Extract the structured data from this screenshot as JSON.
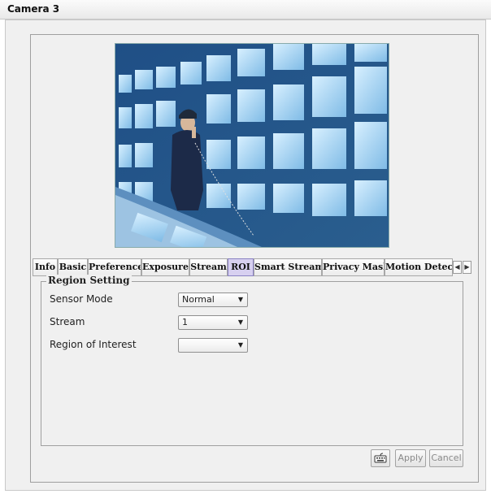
{
  "window": {
    "title": "Camera 3"
  },
  "tabs": [
    {
      "label": "Info"
    },
    {
      "label": "Basic"
    },
    {
      "label": "Preference"
    },
    {
      "label": "Exposure"
    },
    {
      "label": "Stream"
    },
    {
      "label": "ROI",
      "active": true
    },
    {
      "label": "Smart Stream"
    },
    {
      "label": "Privacy Mask"
    },
    {
      "label": "Motion Detecti"
    }
  ],
  "tab_scroll": {
    "left": "◀",
    "right": "▶"
  },
  "region_setting": {
    "title": "Region Setting",
    "fields": [
      {
        "label": "Sensor Mode",
        "value": "Normal"
      },
      {
        "label": "Stream",
        "value": "1"
      },
      {
        "label": "Region of Interest",
        "value": ""
      }
    ]
  },
  "buttons": {
    "icon": "keyboard-icon",
    "apply": "Apply",
    "cancel": "Cancel"
  },
  "colors": {
    "active_tab": "#d7d0f0",
    "window_bg": "#f0f0f0"
  }
}
